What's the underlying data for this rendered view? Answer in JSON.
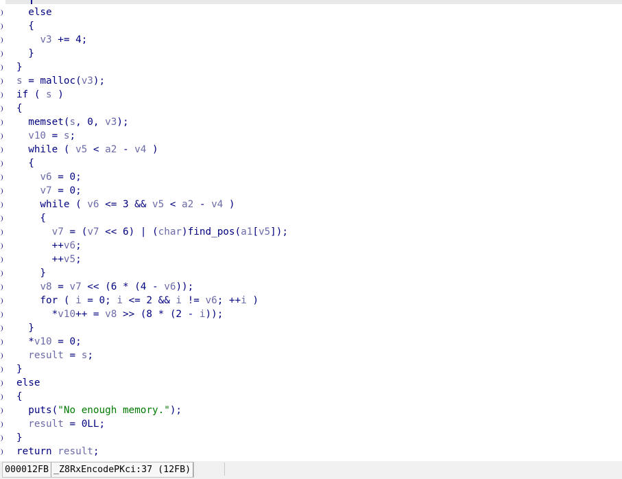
{
  "code_lines": [
    [
      {
        "t": "  else"
      }
    ],
    [
      {
        "t": "  {"
      }
    ],
    [
      {
        "t": "    "
      },
      {
        "t": "v3",
        "c": "v"
      },
      {
        "t": " += 4;"
      }
    ],
    [
      {
        "t": "  }"
      }
    ],
    [
      {
        "t": "}"
      }
    ],
    [
      {
        "t": "s",
        "c": "v"
      },
      {
        "t": " = malloc("
      },
      {
        "t": "v3",
        "c": "v"
      },
      {
        "t": ");"
      }
    ],
    [
      {
        "t": "if ( "
      },
      {
        "t": "s",
        "c": "v"
      },
      {
        "t": " )"
      }
    ],
    [
      {
        "t": "{"
      }
    ],
    [
      {
        "t": "  memset("
      },
      {
        "t": "s",
        "c": "v"
      },
      {
        "t": ", 0, "
      },
      {
        "t": "v3",
        "c": "v"
      },
      {
        "t": ");"
      }
    ],
    [
      {
        "t": "  "
      },
      {
        "t": "v10",
        "c": "v"
      },
      {
        "t": " = "
      },
      {
        "t": "s",
        "c": "v"
      },
      {
        "t": ";"
      }
    ],
    [
      {
        "t": "  while ( "
      },
      {
        "t": "v5",
        "c": "v"
      },
      {
        "t": " < "
      },
      {
        "t": "a2",
        "c": "v"
      },
      {
        "t": " - "
      },
      {
        "t": "v4",
        "c": "v"
      },
      {
        "t": " )"
      }
    ],
    [
      {
        "t": "  {"
      }
    ],
    [
      {
        "t": "    "
      },
      {
        "t": "v6",
        "c": "v"
      },
      {
        "t": " = 0;"
      }
    ],
    [
      {
        "t": "    "
      },
      {
        "t": "v7",
        "c": "v"
      },
      {
        "t": " = 0;"
      }
    ],
    [
      {
        "t": "    while ( "
      },
      {
        "t": "v6",
        "c": "v"
      },
      {
        "t": " <= 3 && "
      },
      {
        "t": "v5",
        "c": "v"
      },
      {
        "t": " < "
      },
      {
        "t": "a2",
        "c": "v"
      },
      {
        "t": " - "
      },
      {
        "t": "v4",
        "c": "v"
      },
      {
        "t": " )"
      }
    ],
    [
      {
        "t": "    {"
      }
    ],
    [
      {
        "t": "      "
      },
      {
        "t": "v7",
        "c": "v"
      },
      {
        "t": " = ("
      },
      {
        "t": "v7",
        "c": "v"
      },
      {
        "t": " << 6) | ("
      },
      {
        "t": "char",
        "c": "v"
      },
      {
        "t": ")find_pos("
      },
      {
        "t": "a1",
        "c": "v"
      },
      {
        "t": "["
      },
      {
        "t": "v5",
        "c": "v"
      },
      {
        "t": "]);"
      }
    ],
    [
      {
        "t": "      ++"
      },
      {
        "t": "v6",
        "c": "v"
      },
      {
        "t": ";"
      }
    ],
    [
      {
        "t": "      ++"
      },
      {
        "t": "v5",
        "c": "v"
      },
      {
        "t": ";"
      }
    ],
    [
      {
        "t": "    }"
      }
    ],
    [
      {
        "t": "    "
      },
      {
        "t": "v8",
        "c": "v"
      },
      {
        "t": " = "
      },
      {
        "t": "v7",
        "c": "v"
      },
      {
        "t": " << (6 * (4 - "
      },
      {
        "t": "v6",
        "c": "v"
      },
      {
        "t": "));"
      }
    ],
    [
      {
        "t": "    for ( "
      },
      {
        "t": "i",
        "c": "v"
      },
      {
        "t": " = 0; "
      },
      {
        "t": "i",
        "c": "v"
      },
      {
        "t": " <= 2 && "
      },
      {
        "t": "i",
        "c": "v"
      },
      {
        "t": " != "
      },
      {
        "t": "v6",
        "c": "v"
      },
      {
        "t": "; ++"
      },
      {
        "t": "i",
        "c": "v"
      },
      {
        "t": " )"
      }
    ],
    [
      {
        "t": "      *"
      },
      {
        "t": "v10",
        "c": "v"
      },
      {
        "t": "++ = "
      },
      {
        "t": "v8",
        "c": "v"
      },
      {
        "t": " >> (8 * (2 - "
      },
      {
        "t": "i",
        "c": "v"
      },
      {
        "t": "));"
      }
    ],
    [
      {
        "t": "  }"
      }
    ],
    [
      {
        "t": "  *"
      },
      {
        "t": "v10",
        "c": "v"
      },
      {
        "t": " = 0;"
      }
    ],
    [
      {
        "t": "  "
      },
      {
        "t": "result",
        "c": "v"
      },
      {
        "t": " = "
      },
      {
        "t": "s",
        "c": "v"
      },
      {
        "t": ";"
      }
    ],
    [
      {
        "t": "}"
      }
    ],
    [
      {
        "t": "else"
      }
    ],
    [
      {
        "t": "{"
      }
    ],
    [
      {
        "t": "  puts("
      },
      {
        "t": "\"No enough memory.\"",
        "c": "s"
      },
      {
        "t": ");"
      }
    ],
    [
      {
        "t": "  "
      },
      {
        "t": "result",
        "c": "v"
      },
      {
        "t": " = 0LL;"
      }
    ],
    [
      {
        "t": "}"
      }
    ],
    [
      {
        "t": "return "
      },
      {
        "t": "result",
        "c": "v"
      },
      {
        "t": ";"
      }
    ]
  ],
  "status": {
    "address": "000012FB",
    "location": "_Z8RxEncodePKci:37 (12FB)"
  },
  "colors": {
    "keyword": "#000080",
    "variable": "#6a6aa8",
    "string": "#007a00",
    "background": "#ffffff"
  }
}
